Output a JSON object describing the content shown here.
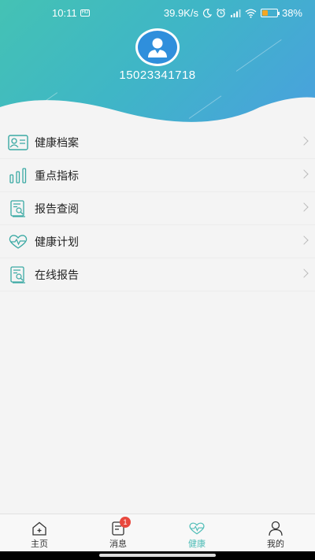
{
  "status_bar": {
    "time": "10:11",
    "network_speed": "39.9K/s",
    "battery_percent": "38%",
    "battery_level": 0.38,
    "icons": [
      "hd-icon",
      "moon-icon",
      "alarm-icon",
      "signal-icon",
      "wifi-icon",
      "battery-icon"
    ]
  },
  "profile": {
    "phone": "15023341718",
    "avatar_icon": "user-avatar-icon"
  },
  "menu": {
    "items": [
      {
        "label": "健康档案",
        "icon": "id-card-icon"
      },
      {
        "label": "重点指标",
        "icon": "bar-chart-icon"
      },
      {
        "label": "报告查阅",
        "icon": "report-search-icon"
      },
      {
        "label": "健康计划",
        "icon": "heart-pulse-icon"
      },
      {
        "label": "在线报告",
        "icon": "report-search-icon"
      }
    ]
  },
  "tabbar": {
    "tabs": [
      {
        "label": "主页",
        "icon": "home-icon"
      },
      {
        "label": "消息",
        "icon": "message-icon",
        "badge": "1"
      },
      {
        "label": "健康",
        "icon": "heart-pulse-icon",
        "active": true
      },
      {
        "label": "我的",
        "icon": "person-icon"
      }
    ]
  },
  "colors": {
    "accent": "#4cbcb6",
    "gradient_start": "#44c2b4",
    "gradient_end": "#4a9fe0",
    "badge": "#e8483e",
    "avatar": "#2f8fdc"
  }
}
